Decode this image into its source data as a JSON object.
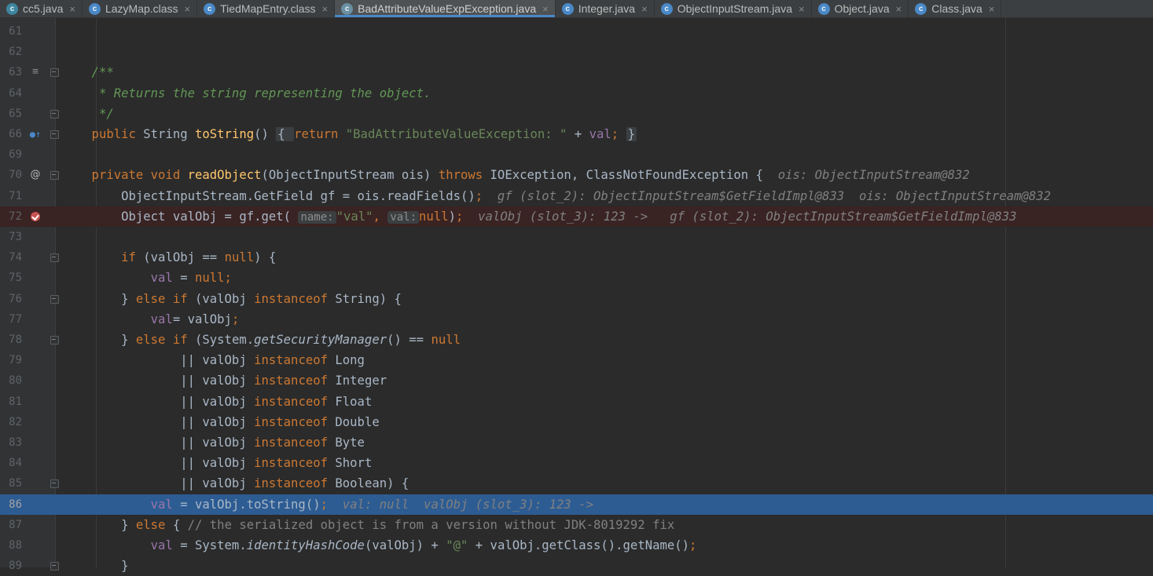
{
  "tabs": [
    {
      "label": "cc5.java",
      "icon": "java-class-icon",
      "active": false
    },
    {
      "label": "LazyMap.class",
      "icon": "class-file-icon",
      "active": false
    },
    {
      "label": "TiedMapEntry.class",
      "icon": "class-file-icon",
      "active": false
    },
    {
      "label": "BadAttributeValueExpException.java",
      "icon": "exception-class-icon",
      "active": true
    },
    {
      "label": "Integer.java",
      "icon": "class-file-icon",
      "active": false
    },
    {
      "label": "ObjectInputStream.java",
      "icon": "class-file-icon",
      "active": false
    },
    {
      "label": "Object.java",
      "icon": "class-file-icon",
      "active": false
    },
    {
      "label": "Class.java",
      "icon": "class-file-icon",
      "active": false
    }
  ],
  "close_glyph": "×",
  "gutter_icons": {
    "63": "javadoc-icon",
    "66": "overrides-method-icon",
    "70": "annotation-icon",
    "72": "breakpoint-icon"
  },
  "lines": [
    {
      "n": "61",
      "tokens": []
    },
    {
      "n": "62",
      "tokens": []
    },
    {
      "n": "63",
      "tokens": [
        [
          "c",
          "    /**"
        ]
      ]
    },
    {
      "n": "64",
      "tokens": [
        [
          "c",
          "     * Returns the string representing the object."
        ]
      ]
    },
    {
      "n": "65",
      "tokens": [
        [
          "c",
          "     */"
        ]
      ]
    },
    {
      "n": "66",
      "tokens": [
        [
          "k",
          "    public "
        ],
        [
          "t",
          "String "
        ],
        [
          "m",
          "toString"
        ],
        [
          "t",
          "() "
        ],
        [
          "fb",
          "{ "
        ],
        [
          "k",
          "return "
        ],
        [
          "s",
          "\"BadAttributeValueException: \" "
        ],
        [
          "t",
          "+ "
        ],
        [
          "f",
          "val"
        ],
        [
          "k",
          ";"
        ],
        [
          "t",
          " "
        ],
        [
          "fb",
          "}"
        ]
      ]
    },
    {
      "n": "69",
      "tokens": []
    },
    {
      "n": "70",
      "tokens": [
        [
          "k",
          "    private void "
        ],
        [
          "m",
          "readObject"
        ],
        [
          "t",
          "(ObjectInputStream ois) "
        ],
        [
          "k",
          "throws "
        ],
        [
          "t",
          "IOException, ClassNotFoundException {  "
        ],
        [
          "h",
          "ois: ObjectInputStream@832"
        ]
      ]
    },
    {
      "n": "71",
      "tokens": [
        [
          "t",
          "        ObjectInputStream.GetField gf = ois.readFields()"
        ],
        [
          "k",
          ";  "
        ],
        [
          "h",
          "gf (slot_2): ObjectInputStream$GetFieldImpl@833  ois: ObjectInputStream@832"
        ]
      ]
    },
    {
      "n": "72",
      "tokens": [
        [
          "t",
          "        Object valObj = gf.get( "
        ],
        [
          "hint",
          "name:"
        ],
        [
          "s",
          "\"val\""
        ],
        [
          "k",
          ", "
        ],
        [
          "hint",
          "val:"
        ],
        [
          "k",
          "null"
        ],
        [
          "t",
          ")"
        ],
        [
          "k",
          ";  "
        ],
        [
          "h",
          "valObj (slot_3): 123 ->   gf (slot_2): ObjectInputStream$GetFieldImpl@833"
        ]
      ]
    },
    {
      "n": "73",
      "tokens": []
    },
    {
      "n": "74",
      "tokens": [
        [
          "k",
          "        if "
        ],
        [
          "t",
          "(valObj == "
        ],
        [
          "k",
          "null"
        ],
        [
          "t",
          ") {"
        ]
      ]
    },
    {
      "n": "75",
      "tokens": [
        [
          "f",
          "            val "
        ],
        [
          "t",
          "= "
        ],
        [
          "k",
          "null;"
        ]
      ]
    },
    {
      "n": "76",
      "tokens": [
        [
          "t",
          "        } "
        ],
        [
          "k",
          "else if "
        ],
        [
          "t",
          "(valObj "
        ],
        [
          "k",
          "instanceof "
        ],
        [
          "t",
          "String) {"
        ]
      ]
    },
    {
      "n": "77",
      "tokens": [
        [
          "f",
          "            val"
        ],
        [
          "t",
          "= valObj"
        ],
        [
          "k",
          ";"
        ]
      ]
    },
    {
      "n": "78",
      "tokens": [
        [
          "t",
          "        } "
        ],
        [
          "k",
          "else if "
        ],
        [
          "t",
          "(System."
        ],
        [
          "i",
          "getSecurityManager"
        ],
        [
          "t",
          "() == "
        ],
        [
          "k",
          "null"
        ]
      ]
    },
    {
      "n": "79",
      "tokens": [
        [
          "t",
          "                || valObj "
        ],
        [
          "k",
          "instanceof "
        ],
        [
          "t",
          "Long"
        ]
      ]
    },
    {
      "n": "80",
      "tokens": [
        [
          "t",
          "                || valObj "
        ],
        [
          "k",
          "instanceof "
        ],
        [
          "t",
          "Integer"
        ]
      ]
    },
    {
      "n": "81",
      "tokens": [
        [
          "t",
          "                || valObj "
        ],
        [
          "k",
          "instanceof "
        ],
        [
          "t",
          "Float"
        ]
      ]
    },
    {
      "n": "82",
      "tokens": [
        [
          "t",
          "                || valObj "
        ],
        [
          "k",
          "instanceof "
        ],
        [
          "t",
          "Double"
        ]
      ]
    },
    {
      "n": "83",
      "tokens": [
        [
          "t",
          "                || valObj "
        ],
        [
          "k",
          "instanceof "
        ],
        [
          "t",
          "Byte"
        ]
      ]
    },
    {
      "n": "84",
      "tokens": [
        [
          "t",
          "                || valObj "
        ],
        [
          "k",
          "instanceof "
        ],
        [
          "t",
          "Short"
        ]
      ]
    },
    {
      "n": "85",
      "tokens": [
        [
          "t",
          "                || valObj "
        ],
        [
          "k",
          "instanceof "
        ],
        [
          "t",
          "Boolean) {"
        ]
      ]
    },
    {
      "n": "86",
      "tokens": [
        [
          "f",
          "            val "
        ],
        [
          "t",
          "= valObj.toString()"
        ],
        [
          "k",
          ";  "
        ],
        [
          "h",
          "val: null  valObj (slot_3): 123 ->"
        ]
      ]
    },
    {
      "n": "87",
      "tokens": [
        [
          "t",
          "        } "
        ],
        [
          "k",
          "else "
        ],
        [
          "t",
          "{ "
        ],
        [
          "lc",
          "// the serialized object is from a version without JDK-8019292 fix"
        ]
      ]
    },
    {
      "n": "88",
      "tokens": [
        [
          "f",
          "            val "
        ],
        [
          "t",
          "= System."
        ],
        [
          "i",
          "identityHashCode"
        ],
        [
          "t",
          "(valObj) + "
        ],
        [
          "s",
          "\"@\" "
        ],
        [
          "t",
          "+ valObj.getClass().getName()"
        ],
        [
          "k",
          ";"
        ]
      ]
    },
    {
      "n": "89",
      "tokens": [
        [
          "t",
          "        }"
        ]
      ]
    }
  ],
  "line_states": {
    "72": "breakpoint",
    "86": "current-execution"
  },
  "fold_markers": [
    "63",
    "65",
    "66",
    "70",
    "74",
    "76",
    "78",
    "85",
    "89"
  ],
  "colors": {
    "keyword": "#cc7832",
    "method": "#ffc66d",
    "string": "#6a8759",
    "field": "#9876aa",
    "doc_comment": "#629755",
    "breakpoint_line": "#3a2323",
    "execution_line": "#2d5c93",
    "tab_active_underline": "#4a88c7"
  }
}
